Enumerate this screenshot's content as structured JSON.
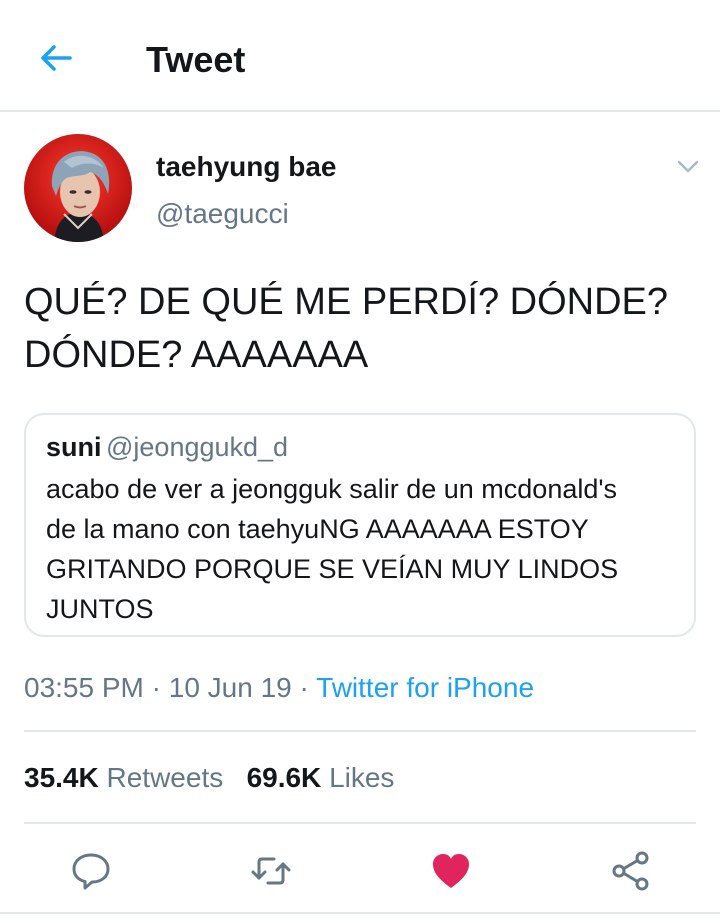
{
  "header": {
    "title": "Tweet",
    "back_icon": "arrow-left-icon",
    "accent": "#1da1f2"
  },
  "tweet": {
    "author": {
      "name": "taehyung bae",
      "handle": "@taegucci"
    },
    "text_lines": [
      "QUÉ? DE QUÉ ME PERDÍ? DÓNDE?",
      "DÓNDE? AAAAAAA"
    ],
    "quoted": {
      "author_name": "suni",
      "author_handle": "@jeonggukd_d",
      "text_lines": [
        "acabo de ver a jeongguk salir de un mcdonald's",
        "de la mano con taehyuNG AAAAAAA ESTOY",
        "GRITANDO PORQUE SE VEÍAN MUY LINDOS",
        "JUNTOS"
      ]
    },
    "time": "03:55 PM",
    "separator": " · ",
    "date": "10 Jun 19",
    "source": "Twitter for iPhone",
    "stats": {
      "retweets_count": "35.4K",
      "retweets_label": "Retweets",
      "likes_count": "69.6K",
      "likes_label": "Likes"
    }
  },
  "actions": [
    {
      "icon": "reply-icon"
    },
    {
      "icon": "retweet-icon"
    },
    {
      "icon": "heart-icon",
      "active": true,
      "color": "#e0245e"
    },
    {
      "icon": "share-icon"
    }
  ]
}
